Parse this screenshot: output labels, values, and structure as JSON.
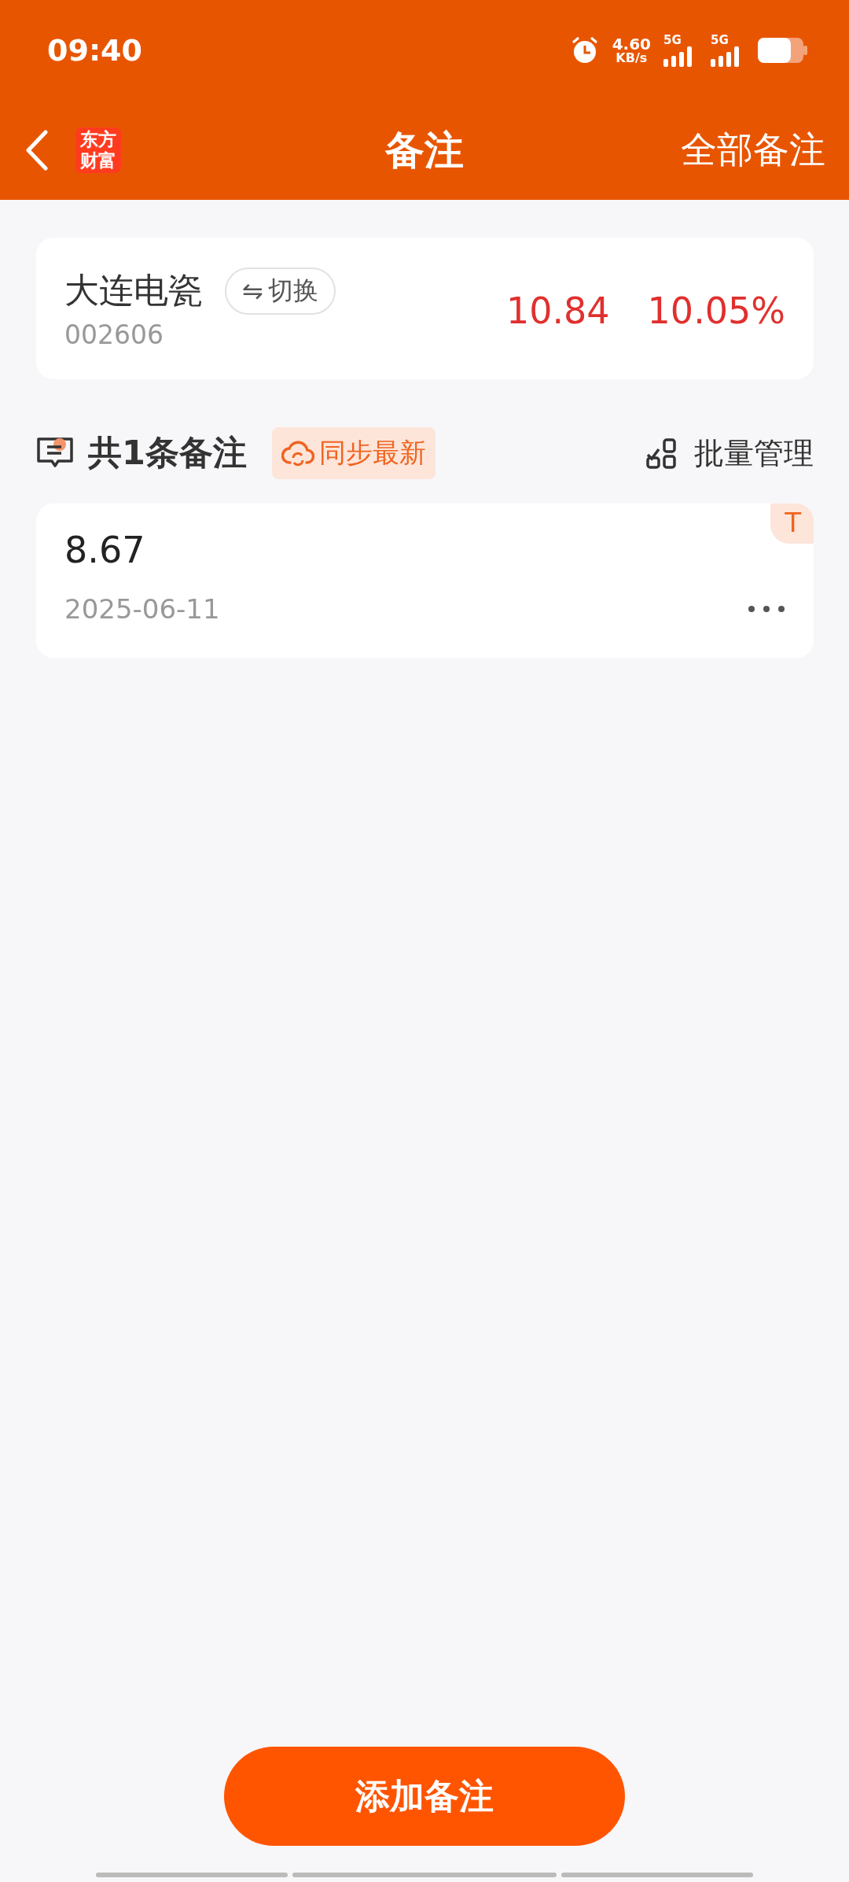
{
  "status_bar": {
    "time": "09:40",
    "speed": "4.60",
    "speed_unit": "KB/s",
    "networks": [
      "5G",
      "5G"
    ]
  },
  "header": {
    "logo": "东方财富",
    "title": "备注",
    "action": "全部备注"
  },
  "stock": {
    "name": "大连电瓷",
    "switch_label": "切换",
    "switch_symbol": "⇋",
    "code": "002606",
    "price": "10.84",
    "change": "10.05%",
    "rising": true
  },
  "notes_header": {
    "title": "共1条备注",
    "sync_label": "同步最新",
    "manage_label": "批量管理"
  },
  "notes": [
    {
      "text": "8.67",
      "date": "2025-06-11",
      "tag": "T"
    }
  ],
  "add_button": "添加备注"
}
